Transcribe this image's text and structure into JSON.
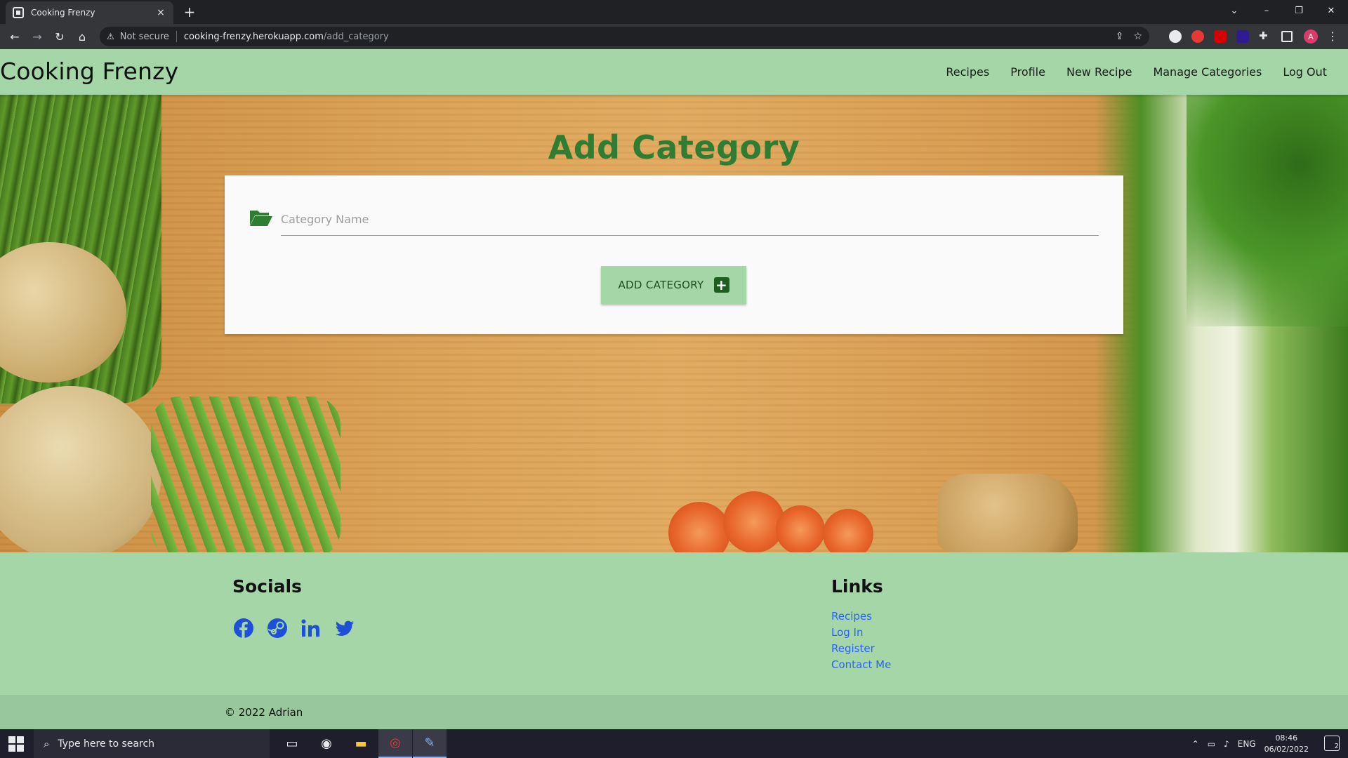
{
  "browser": {
    "tab_title": "Cooking Frenzy",
    "tab_close": "×",
    "new_tab": "+",
    "window_controls": [
      "⌄",
      "–",
      "❐",
      "✕"
    ],
    "security_label": "Not secure",
    "url_host": "cooking-frenzy.herokuapp.com",
    "url_path": "/add_category",
    "profile_initial": "A"
  },
  "site": {
    "brand": "Cooking Frenzy",
    "nav": [
      "Recipes",
      "Profile",
      "New Recipe",
      "Manage Categories",
      "Log Out"
    ]
  },
  "main": {
    "title": "Add Category",
    "category_placeholder": "Category Name",
    "category_value": "",
    "submit_label": "ADD CATEGORY"
  },
  "footer": {
    "socials_title": "Socials",
    "socials": [
      "facebook-icon",
      "steam-icon",
      "linkedin-icon",
      "twitter-icon"
    ],
    "links_title": "Links",
    "links": [
      "Recipes",
      "Log In",
      "Register",
      "Contact Me"
    ],
    "copyright": "© 2022 Adrian"
  },
  "taskbar": {
    "search_placeholder": "Type here to search",
    "language": "ENG",
    "time": "08:46",
    "date": "06/02/2022",
    "notification_count": "2"
  },
  "colors": {
    "nav_bg": "#a5d6a7",
    "title_green": "#2e7d32",
    "link_blue": "#2962ff",
    "icon_blue": "#1e4fd8",
    "button_icon_green": "#1b5e20"
  }
}
